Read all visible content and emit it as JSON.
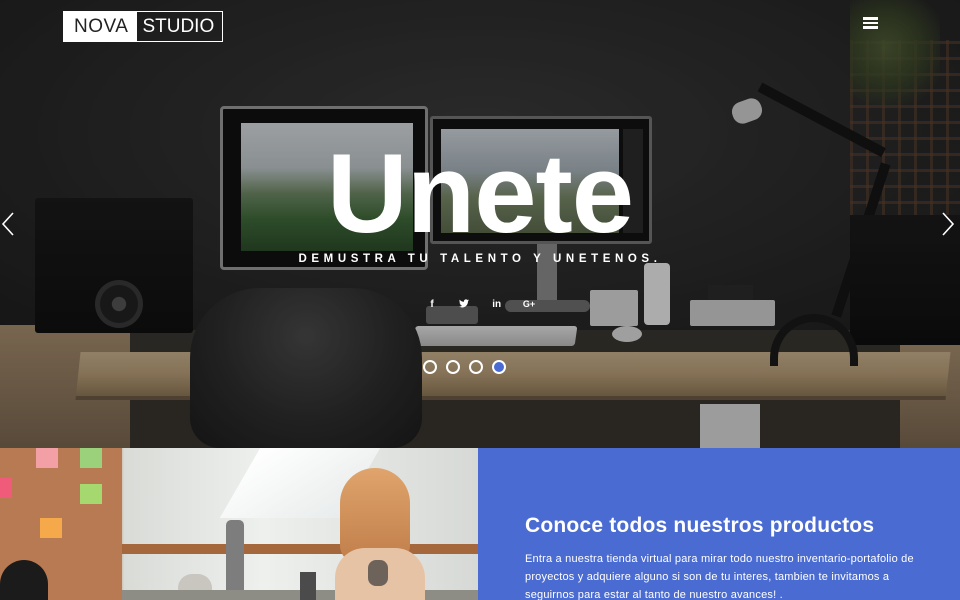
{
  "brand": {
    "part1": "NOVA",
    "part2": "STUDIO"
  },
  "nav": {
    "menu_icon": "hamburger-icon"
  },
  "hero": {
    "title": "Unete",
    "subtitle": "DEMUSTRA TU TALENTO Y UNETENOS.",
    "social": [
      {
        "icon": "facebook-icon",
        "glyph": "f"
      },
      {
        "icon": "twitter-icon",
        "glyph": "t"
      },
      {
        "icon": "linkedin-icon",
        "glyph": "in"
      },
      {
        "icon": "google-plus-icon",
        "glyph": "G+"
      }
    ],
    "slides_total": 4,
    "active_slide": 4,
    "prev_icon": "chevron-left-icon",
    "next_icon": "chevron-right-icon"
  },
  "promo": {
    "title": "Conoce todos nuestros productos",
    "text": "Entra a nuestra tienda virtual para mirar todo nuestro inventario-portafolio de proyectos y adquiere alguno si son de tu interes, tambien te invitamos a seguirnos para estar al tanto de nuestro avances! ."
  },
  "colors": {
    "accent": "#4a6bd1",
    "text": "#ffffff"
  }
}
